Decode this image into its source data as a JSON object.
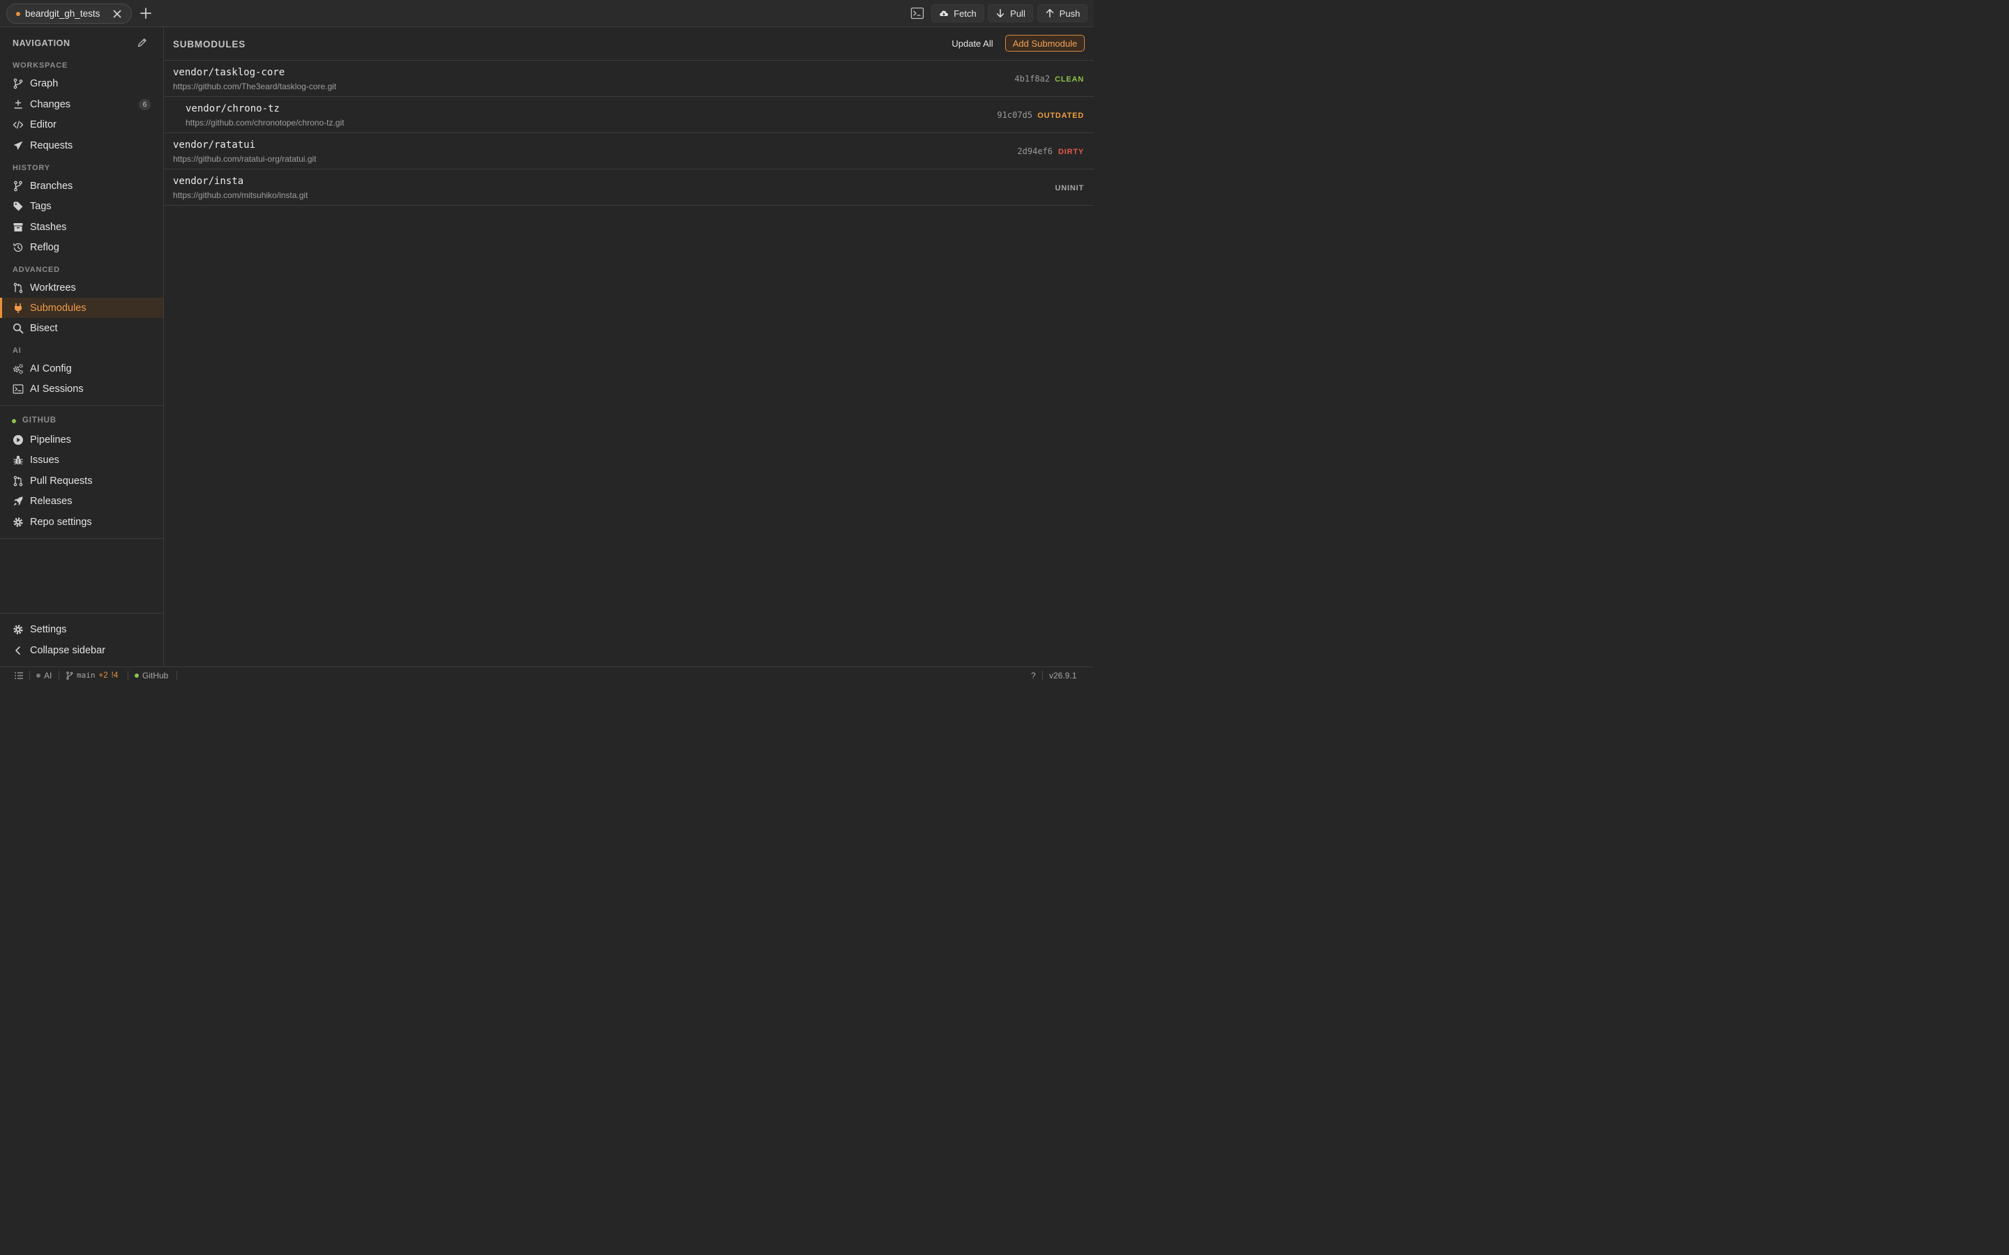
{
  "colors": {
    "accent": "#e8913d",
    "repo_dot": "#e8913d",
    "github_dot": "#8bc34a",
    "clean": "#8bc34a",
    "outdated": "#f0a03c",
    "dirty": "#e05a4a",
    "uninit": "#a8a8a8"
  },
  "tab": {
    "label": "beardgit_gh_tests"
  },
  "toolbar": {
    "fetch": "Fetch",
    "pull": "Pull",
    "push": "Push"
  },
  "sidebar": {
    "title": "NAVIGATION",
    "sections": {
      "workspace": "WORKSPACE",
      "history": "HISTORY",
      "advanced": "ADVANCED",
      "ai": "AI",
      "github": "GITHUB"
    },
    "workspace": [
      {
        "label": "Graph",
        "icon": "git-branch-icon"
      },
      {
        "label": "Changes",
        "icon": "plus-minus-icon",
        "badge": "6"
      },
      {
        "label": "Editor",
        "icon": "code-icon"
      },
      {
        "label": "Requests",
        "icon": "send-icon"
      }
    ],
    "history": [
      {
        "label": "Branches",
        "icon": "branch-icon"
      },
      {
        "label": "Tags",
        "icon": "tag-icon"
      },
      {
        "label": "Stashes",
        "icon": "archive-icon"
      },
      {
        "label": "Reflog",
        "icon": "history-icon"
      }
    ],
    "advanced": [
      {
        "label": "Worktrees",
        "icon": "worktree-icon"
      },
      {
        "label": "Submodules",
        "icon": "plug-icon"
      },
      {
        "label": "Bisect",
        "icon": "search-icon"
      }
    ],
    "ai": [
      {
        "label": "AI Config",
        "icon": "gears-icon"
      },
      {
        "label": "AI Sessions",
        "icon": "terminal-icon"
      }
    ],
    "github": [
      {
        "label": "Pipelines",
        "icon": "play-icon"
      },
      {
        "label": "Issues",
        "icon": "bug-icon"
      },
      {
        "label": "Pull Requests",
        "icon": "pull-request-icon"
      },
      {
        "label": "Releases",
        "icon": "rocket-icon"
      },
      {
        "label": "Repo settings",
        "icon": "gear-icon"
      }
    ],
    "footer": [
      {
        "label": "Settings",
        "icon": "gear-icon"
      },
      {
        "label": "Collapse sidebar",
        "icon": "chevron-left-icon"
      }
    ]
  },
  "main": {
    "title": "SUBMODULES",
    "update_all": "Update All",
    "add_submodule": "Add Submodule",
    "submodules": [
      {
        "name": "vendor/tasklog-core",
        "url": "https://github.com/The3eard/tasklog-core.git",
        "hash": "4b1f8a2",
        "status": "CLEAN"
      },
      {
        "name": "vendor/chrono-tz",
        "url": "https://github.com/chronotope/chrono-tz.git",
        "hash": "91c07d5",
        "status": "OUTDATED"
      },
      {
        "name": "vendor/ratatui",
        "url": "https://github.com/ratatui-org/ratatui.git",
        "hash": "2d94ef6",
        "status": "DIRTY"
      },
      {
        "name": "vendor/insta",
        "url": "https://github.com/mitsuhiko/insta.git",
        "hash": "",
        "status": "UNINIT"
      }
    ]
  },
  "statusbar": {
    "ai": "AI",
    "branch": "main",
    "added": "+2",
    "modified": "!4",
    "github": "GitHub",
    "help": "?",
    "version": "v26.9.1"
  }
}
